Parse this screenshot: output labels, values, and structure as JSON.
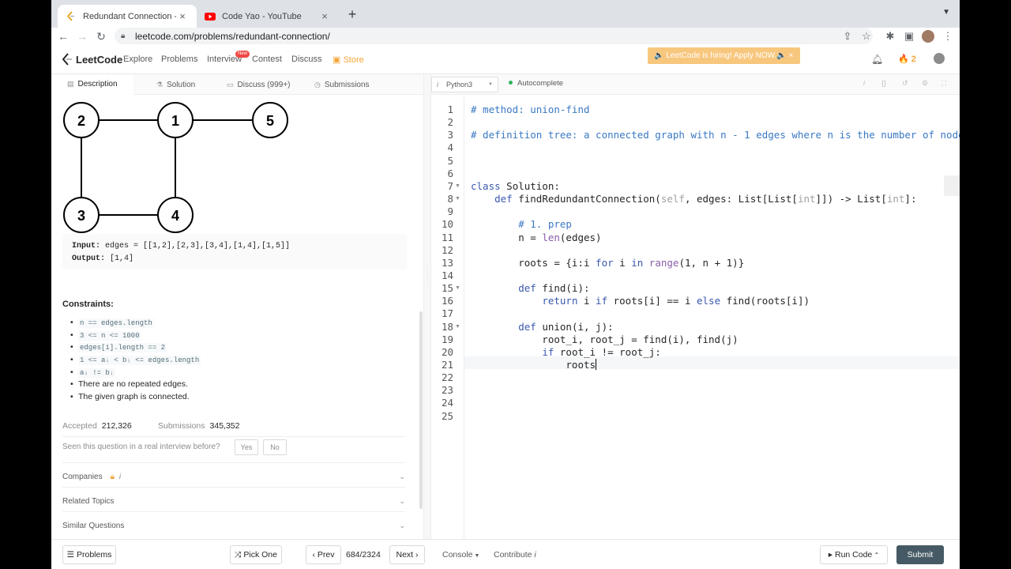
{
  "browser": {
    "tabs": [
      {
        "title": "Redundant Connection - LeetC",
        "close": "×"
      },
      {
        "title": "Code Yao - YouTube",
        "close": "×"
      }
    ],
    "new_tab": "+",
    "url": "leetcode.com/problems/redundant-connection/"
  },
  "nav": {
    "logo": "LeetCode",
    "links": [
      "Explore",
      "Problems",
      "Interview",
      "Contest",
      "Discuss",
      "Store"
    ],
    "new_badge": "New",
    "hiring": "🔈 LeetCode is hiring! Apply NOW.🔈  ×",
    "streak": "2"
  },
  "left": {
    "tabs": [
      "Description",
      "Solution",
      "Discuss (999+)",
      "Submissions"
    ],
    "graph_nodes": [
      "2",
      "1",
      "5",
      "3",
      "4"
    ],
    "example": {
      "input_label": "Input:",
      "input": " edges = [[1,2],[2,3],[3,4],[1,4],[1,5]]",
      "output_label": "Output:",
      "output": " [1,4]"
    },
    "constraints_title": "Constraints:",
    "constraints": [
      "n == edges.length",
      "3 <= n <= 1000",
      "edges[i].length == 2",
      "1 <= aᵢ < bᵢ <= edges.length",
      "aᵢ != bᵢ",
      "There are no repeated edges.",
      "The given graph is connected."
    ],
    "accepted_label": "Accepted",
    "accepted": "212,326",
    "submissions_label": "Submissions",
    "submissions": "345,352",
    "seen": "Seen this question in a real interview before?",
    "yes": "Yes",
    "no": "No",
    "companies": "Companies",
    "related": "Related Topics",
    "similar": "Similar Questions"
  },
  "editor": {
    "language": "Python3",
    "autocomplete": "Autocomplete"
  },
  "code_lines": [
    "# method: union-find",
    "",
    "# definition tree: a connected graph with n - 1 edges where n is the number of node",
    "",
    "",
    "",
    "class Solution:",
    "    def findRedundantConnection(self, edges: List[List[int]]) -> List[int]:",
    "",
    "        # 1. prep",
    "        n = len(edges)",
    "",
    "        roots = {i:i for i in range(1, n + 1)}",
    "",
    "        def find(i):",
    "            return i if roots[i] == i else find(roots[i])",
    "",
    "        def union(i, j):",
    "            root_i, root_j = find(i), find(j)",
    "            if root_i != root_j:",
    "                roots",
    "",
    "",
    "",
    ""
  ],
  "bottom": {
    "problems": "Problems",
    "pick_one": "Pick One",
    "prev": "Prev",
    "page": "684/2324",
    "next": "Next",
    "console": "Console",
    "contribute": "Contribute",
    "run_code": "Run Code",
    "submit": "Submit"
  },
  "colors": {
    "accent_orange": "#ffa116",
    "submit": "#455a64",
    "comment": "#3a78c3"
  }
}
